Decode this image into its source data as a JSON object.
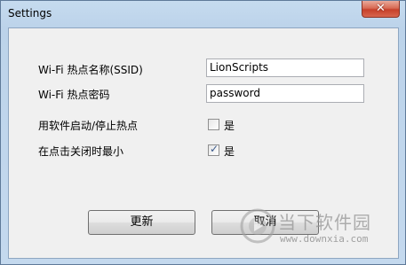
{
  "window": {
    "title": "Settings",
    "close_glyph": "✕"
  },
  "fields": {
    "ssid_label": "Wi-Fi 热点名称(SSID)",
    "ssid_value": "LionScripts",
    "password_label": "Wi-Fi 热点密码",
    "password_value": "password"
  },
  "options": {
    "autostart_label": "用软件启动/停止热点",
    "autostart_checked": false,
    "autostart_text": "是",
    "minimize_label": "在点击关闭时最小",
    "minimize_checked": true,
    "minimize_text": "是"
  },
  "buttons": {
    "update": "更新",
    "cancel": "取消"
  },
  "watermark": {
    "text": "当下软件园",
    "url": "www.downxia.com"
  }
}
